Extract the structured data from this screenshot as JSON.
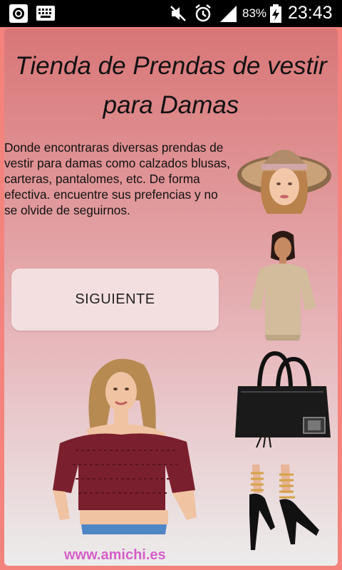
{
  "status_bar": {
    "battery": "83%",
    "time": "23:43",
    "icons": [
      "target-icon",
      "keyboard-icon",
      "mute-icon",
      "alarm-icon",
      "signal-icon",
      "battery-charging-icon"
    ]
  },
  "page": {
    "title_line1": "Tienda de Prendas de vestir",
    "title_line2": "para Damas",
    "description": "Donde encontraras diversas prendas de vestir para damas como calzados blusas, carteras, pantalomes, etc. De forma efectiva. encuentre sus prefencias y no se olvide de seguirnos.",
    "button_label": "SIGUIENTE",
    "footer": "www.amichi.es"
  },
  "colors": {
    "status_bar": "#000000",
    "gradient_top": "#d97677",
    "gradient_bottom": "#ececec",
    "outer_frame": "#f4837d",
    "footer_text": "#d75fc8",
    "button_bg": "#f4dfe0"
  }
}
